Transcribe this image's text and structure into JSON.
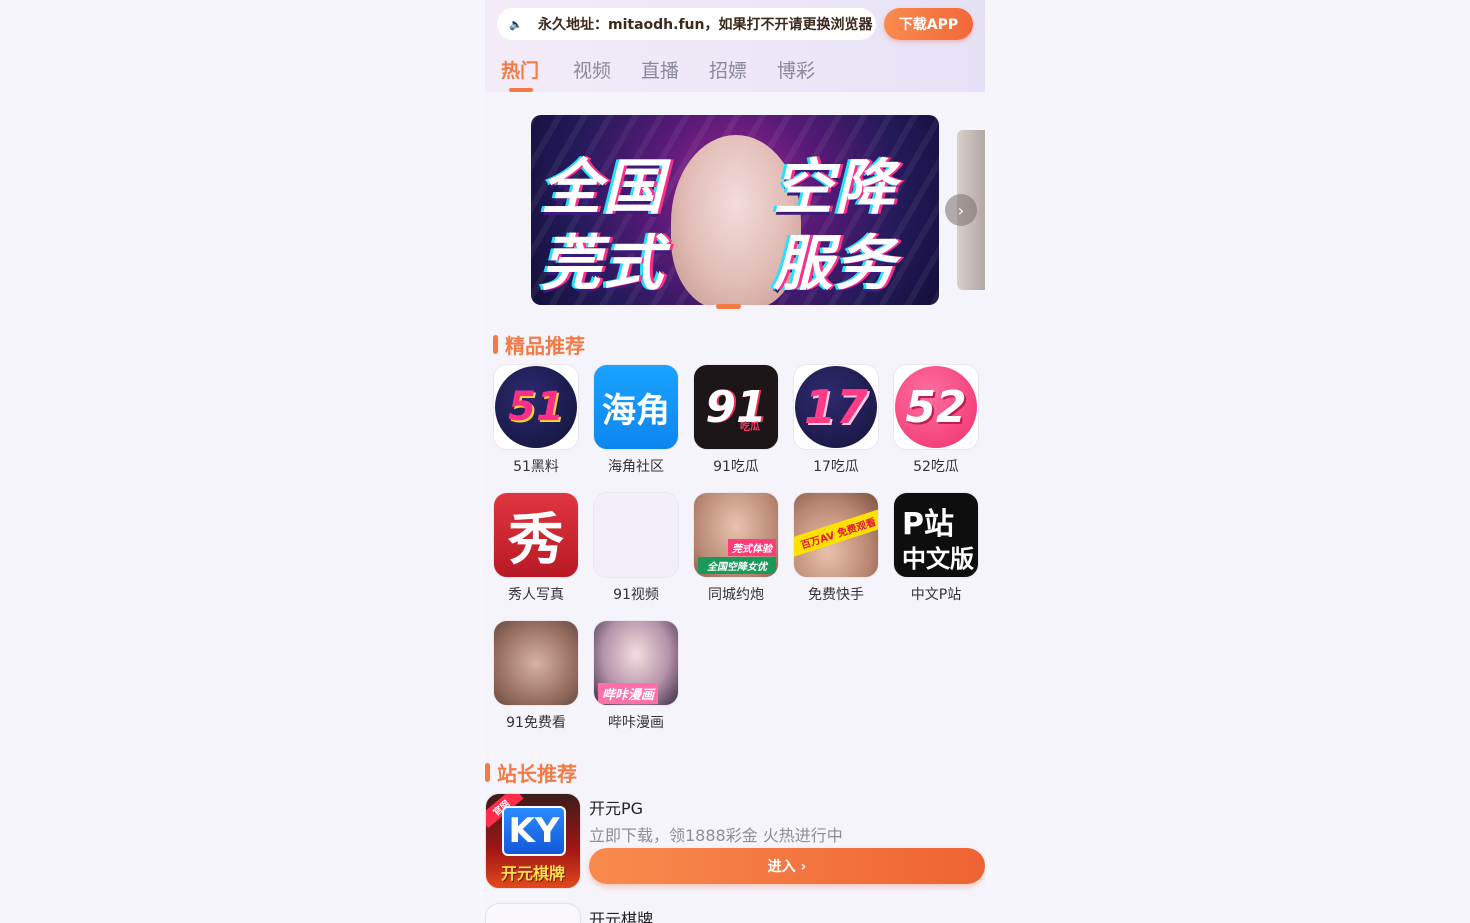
{
  "notice": {
    "icon": "speaker-icon",
    "text": "永久地址：mitaodh.fun，如果打不开请更换浏览器"
  },
  "header": {
    "download_label": "下载APP"
  },
  "tabs": [
    {
      "label": "热门",
      "active": true
    },
    {
      "label": "视频",
      "active": false
    },
    {
      "label": "直播",
      "active": false
    },
    {
      "label": "招嫖",
      "active": false
    },
    {
      "label": "博彩",
      "active": false
    }
  ],
  "banner": {
    "line1_left": "全国",
    "line1_right": "空降",
    "line2_left": "莞式",
    "line2_right": "服务",
    "next_label": "›",
    "active_slide": 1
  },
  "featured": {
    "title": "精品推荐",
    "apps": [
      {
        "label": "51黑料",
        "logo_text": "51"
      },
      {
        "label": "海角社区",
        "logo_text": "海角"
      },
      {
        "label": "91吃瓜",
        "logo_text": "91",
        "logo_sub": "吃瓜"
      },
      {
        "label": "17吃瓜",
        "logo_text": "17"
      },
      {
        "label": "52吃瓜",
        "logo_text": "52"
      },
      {
        "label": "秀人写真",
        "logo_text": "秀"
      },
      {
        "label": "91视频",
        "logo_text": ""
      },
      {
        "label": "同城约炮",
        "logo_text": "全国空降女优",
        "logo_sub": "莞式体验"
      },
      {
        "label": "免费快手",
        "logo_text": "百万AV 免费观看"
      },
      {
        "label": "中文P站",
        "logo_text": "P站",
        "logo_sub": "中文版"
      },
      {
        "label": "91免费看",
        "logo_text": ""
      },
      {
        "label": "哔咔漫画",
        "logo_text": "哔咔漫画"
      }
    ]
  },
  "webmaster": {
    "title": "站长推荐",
    "items": [
      {
        "name": "开元PG",
        "desc": "立即下载，领1888彩金 火热进行中",
        "button": "进入 ›",
        "logo_text": "KY",
        "logo_sub": "开元棋牌",
        "logo_tag": "官网"
      },
      {
        "name": "开元棋牌"
      }
    ]
  },
  "colors": {
    "accent": "#f47a44",
    "header_bg": "#ece6f7",
    "page_bg": "#f6f4fb"
  }
}
